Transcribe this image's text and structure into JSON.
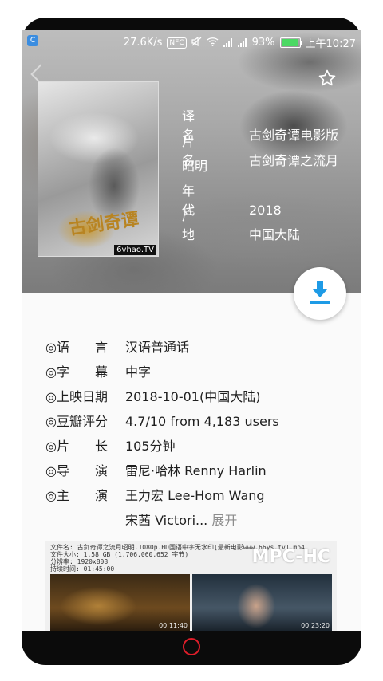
{
  "status_bar": {
    "app_badge": "C",
    "net_speed": "27.6K/s",
    "nfc": "NFC",
    "net_type": "4G",
    "battery": "93%",
    "battery_level": 0.93,
    "time": "上午10:27"
  },
  "poster": {
    "watermark": "6vhao.TV",
    "calligraphy": "古剑奇谭"
  },
  "header": {
    "rows": [
      {
        "key_a": "译",
        "key_b": "名",
        "value": "古剑奇谭电影版"
      },
      {
        "key_a": "片",
        "key_b": "名",
        "value": "古剑奇谭之流月"
      },
      {
        "key_a": "昭明",
        "key_b": "",
        "value": ""
      },
      {
        "key_a": "年",
        "key_b": "代",
        "value": "2018"
      },
      {
        "key_a": "产",
        "key_b": "地",
        "value": "中国大陆"
      }
    ]
  },
  "info": [
    {
      "label": "◎语　　言",
      "value": "汉语普通话"
    },
    {
      "label": "◎字　　幕",
      "value": "中字"
    },
    {
      "label": "◎上映日期",
      "value": "2018-10-01(中国大陆)"
    },
    {
      "label": "◎豆瓣评分",
      "value": "4.7/10 from 4,183 users"
    },
    {
      "label": "◎片　　长",
      "value": "105分钟"
    },
    {
      "label": "◎导　　演",
      "value": "雷尼·哈林 Renny Harlin"
    },
    {
      "label": "◎主　　演",
      "value": "王力宏 Lee-Hom Wang"
    }
  ],
  "cast_more": {
    "value": "宋茜 Victori...",
    "expand": "展开"
  },
  "screenshot": {
    "meta_lines": [
      "文件名: 古剑奇谭之流月昭明.1080p.HD国语中字无水印[最新电影www.66ys.tv].mp4",
      "文件大小: 1.58 GB (1,706,060,652 字节)",
      "分辨率: 1920x808",
      "持续时间: 01:45:00"
    ],
    "brand": "MPC-HC",
    "time1": "00:11:40",
    "time2": "00:23:20"
  }
}
